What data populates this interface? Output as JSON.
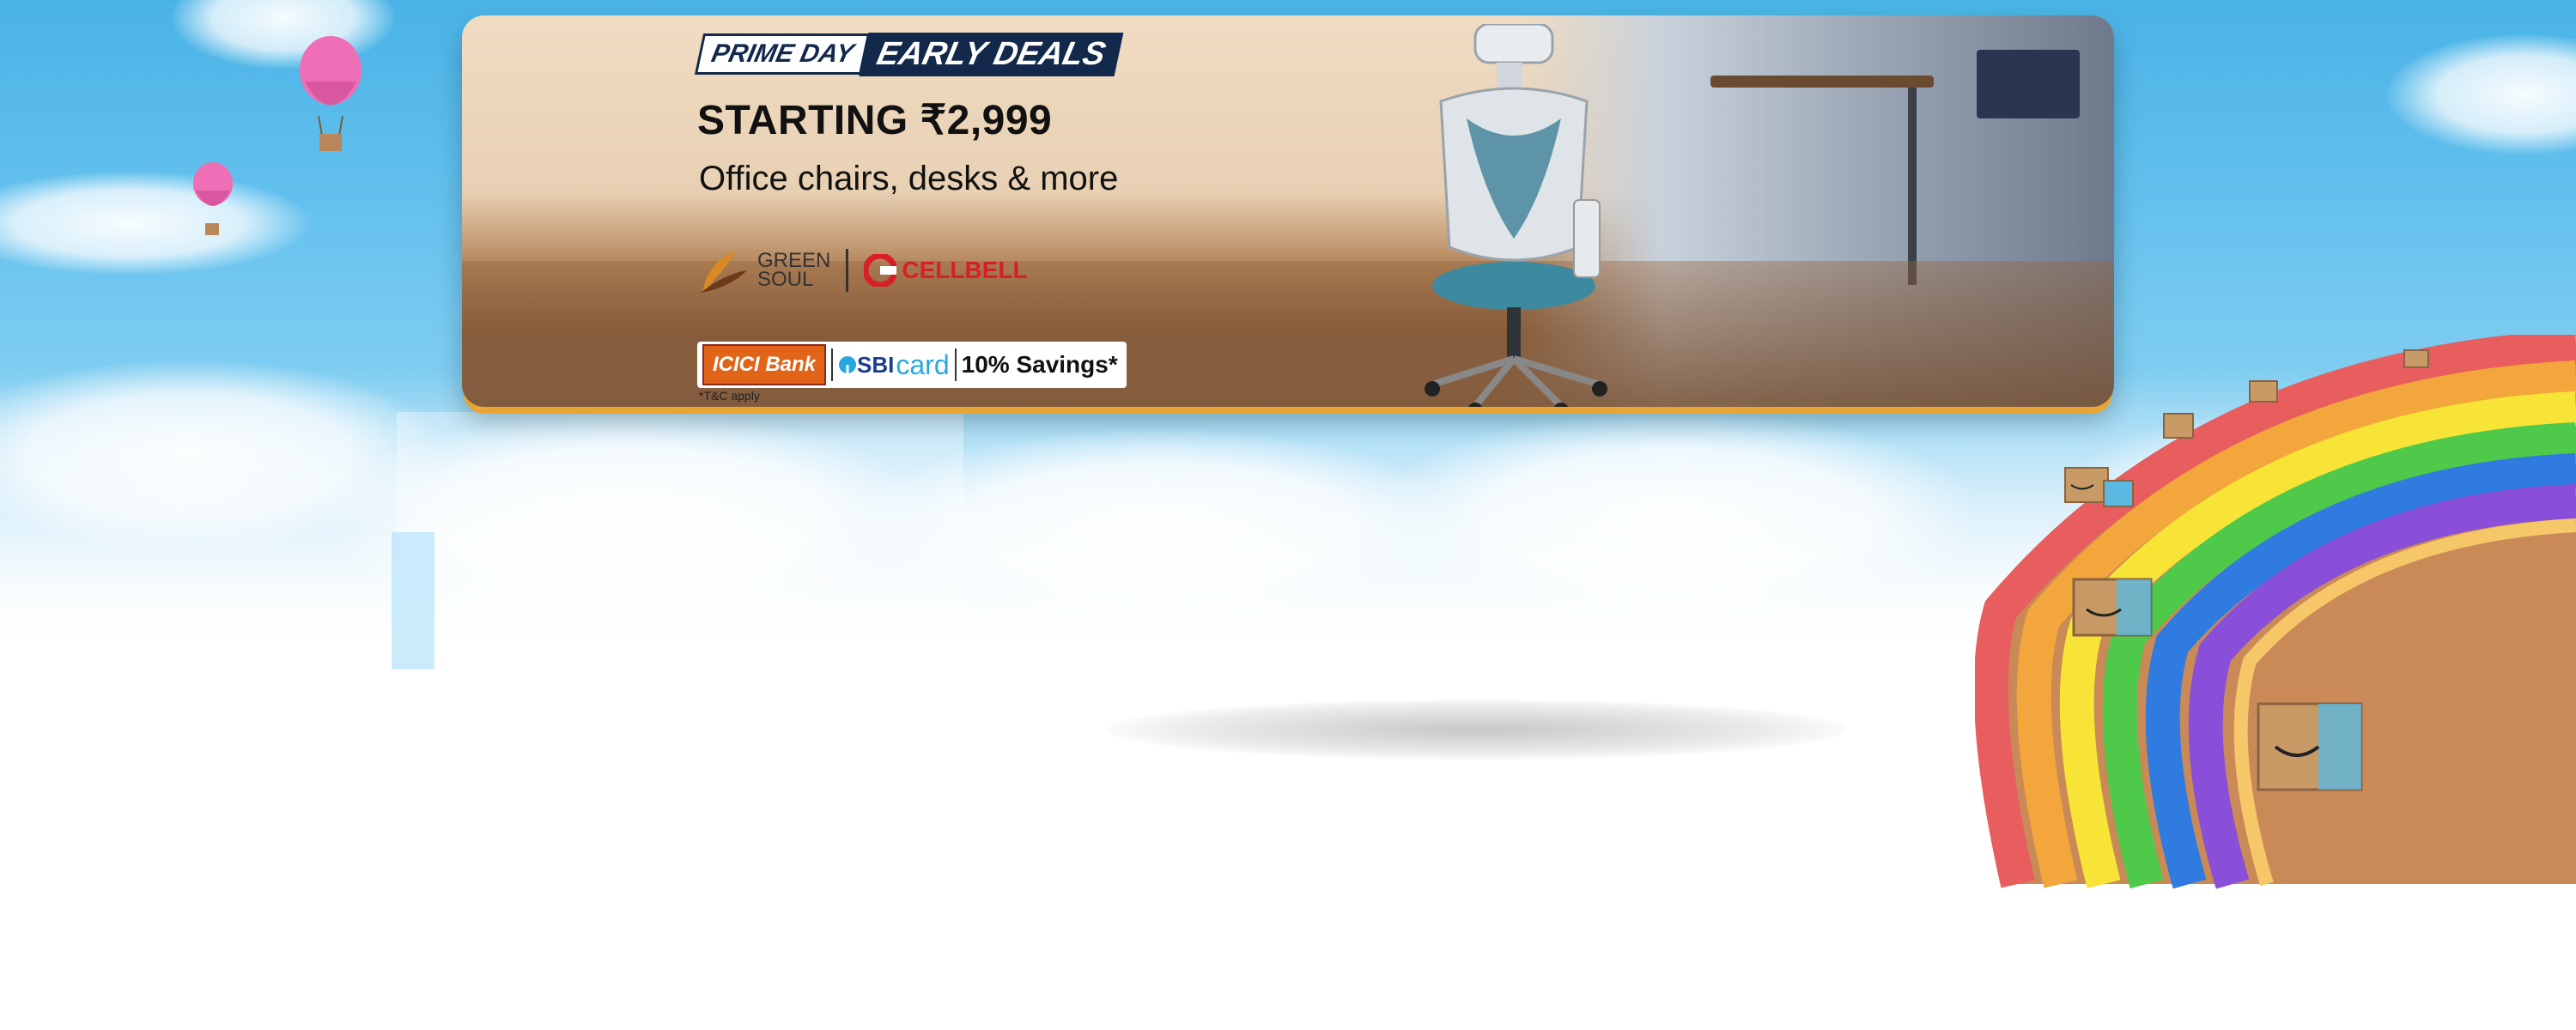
{
  "banner": {
    "tag_prime": "PRIME DAY",
    "tag_early": "EARLY DEALS",
    "headline": "STARTING ₹2,999",
    "subline": "Office chairs, desks & more",
    "brand1_line1": "GREEN",
    "brand1_line2": "SOUL",
    "brand2": "CELLBELL",
    "bank1": "ICICI Bank",
    "bank2_a": "SBI",
    "bank2_b": "card",
    "savings": "10% Savings*",
    "tnc": "*T&C apply"
  },
  "colors": {
    "prime_navy": "#13294b",
    "accent_orange": "#e9a533",
    "cellbell_red": "#d71f26",
    "icici_orange": "#e26418",
    "sbi_blue": "#27a7df"
  },
  "icons": [
    "hot-air-balloon-icon",
    "office-chair-image",
    "greensoul-logo",
    "cellbell-logo",
    "amazon-box-icon"
  ]
}
